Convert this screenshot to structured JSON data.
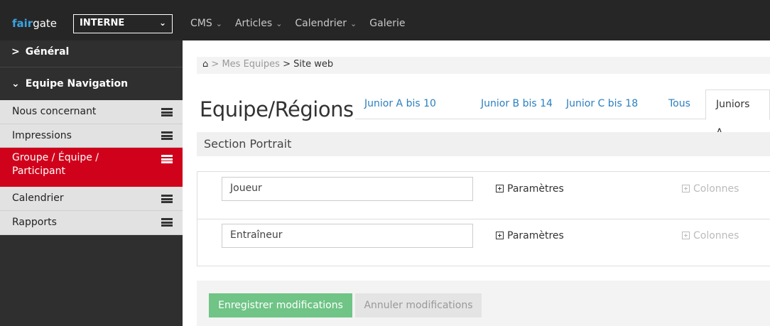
{
  "topbar": {
    "logo_prefix": "fair",
    "logo_suffix": "gate",
    "org_select": "INTERNE",
    "nav": [
      {
        "label": "CMS"
      },
      {
        "label": "Articles"
      },
      {
        "label": "Calendrier"
      },
      {
        "label": "Galerie"
      }
    ],
    "caret": "⌄"
  },
  "sidebar": {
    "general_label": "Général",
    "equipe_nav_label": "Equipe Navigation",
    "items": [
      {
        "label": "Nous concernant"
      },
      {
        "label": "Impressions"
      },
      {
        "label": "Groupe / Équipe / Participant",
        "active": true
      },
      {
        "label": "Calendrier"
      },
      {
        "label": "Rapports"
      }
    ]
  },
  "breadcrumb": {
    "home_icon": "⌂",
    "sep": ">",
    "items": [
      "Mes Equipes",
      "Site web"
    ]
  },
  "page_title": "Equipe/Régions",
  "tabs": [
    {
      "label": "Junior A bis 10"
    },
    {
      "label": "Junior B bis 14"
    },
    {
      "label": "Junior C bis 18"
    },
    {
      "label": "Tous"
    },
    {
      "label": "Juniors A",
      "active": true
    }
  ],
  "section_title": "Section Portrait",
  "rows": [
    {
      "value": "Joueur",
      "params": "Paramètres",
      "cols": "Colonnes"
    },
    {
      "value": "Entraîneur",
      "params": "Paramètres",
      "cols": "Colonnes"
    }
  ],
  "buttons": {
    "save": "Enregistrer modifications",
    "cancel": "Annuler modifications"
  },
  "colors": {
    "topbar_bg": "#262626",
    "sidebar_bg": "#2f2f2f",
    "active_item": "#d0021b",
    "link_blue": "#2a7fbf",
    "save_green": "#6fc486"
  }
}
